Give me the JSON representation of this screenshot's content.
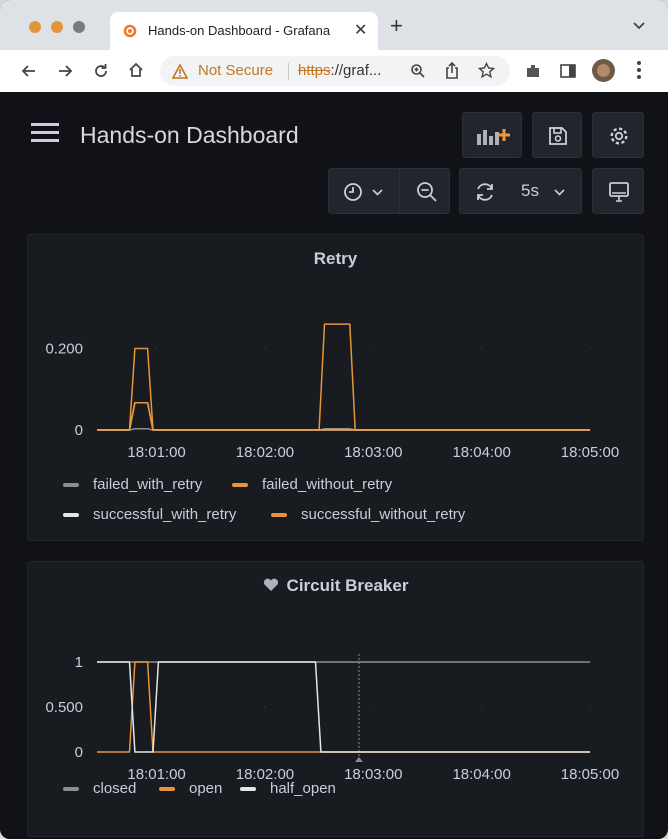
{
  "browser": {
    "tab_title": "Hands-on Dashboard - Grafana",
    "not_secure": "Not Secure",
    "url_scheme": "https",
    "url_rest": "://graf..."
  },
  "dashboard": {
    "title": "Hands-on Dashboard",
    "refresh_interval": "5s"
  },
  "colors": {
    "orange": "#e8953a",
    "gray": "#8e8e8e",
    "white": "#e6e6e6",
    "background": "#111217",
    "panel": "#181b1f"
  },
  "panels": [
    {
      "title": "Retry",
      "legend": [
        {
          "label": "failed_with_retry",
          "color": "#8e8e8e"
        },
        {
          "label": "failed_without_retry",
          "color": "#e8953a"
        },
        {
          "label": "successful_with_retry",
          "color": "#e6e6e6"
        },
        {
          "label": "successful_without_retry",
          "color": "#e8953a"
        }
      ]
    },
    {
      "title": "Circuit Breaker",
      "legend": [
        {
          "label": "closed",
          "color": "#8e8e8e"
        },
        {
          "label": "open",
          "color": "#e8953a"
        },
        {
          "label": "half_open",
          "color": "#e6e6e6"
        }
      ]
    }
  ],
  "chart_data": [
    {
      "type": "line",
      "title": "Retry",
      "x_ticks": [
        "18:01:00",
        "18:02:00",
        "18:03:00",
        "18:04:00",
        "18:05:00"
      ],
      "y_ticks": [
        "0",
        "0.200"
      ],
      "xlim": [
        "18:00:27",
        "18:05:00"
      ],
      "ylim": [
        0,
        0.27
      ],
      "series": [
        {
          "name": "failed_with_retry",
          "color": "#8e8e8e",
          "x": [
            "18:00:27",
            "18:00:45",
            "18:00:48",
            "18:00:55",
            "18:00:58",
            "18:02:30",
            "18:02:33",
            "18:02:47",
            "18:02:50",
            "18:05:00"
          ],
          "y": [
            0,
            0,
            0.003,
            0.003,
            0,
            0,
            0.003,
            0.003,
            0,
            0
          ]
        },
        {
          "name": "failed_without_retry",
          "color": "#e8953a",
          "x": [
            "18:00:27",
            "18:00:45",
            "18:00:48",
            "18:00:55",
            "18:00:58",
            "18:02:30",
            "18:02:33",
            "18:02:47",
            "18:02:50",
            "18:05:00"
          ],
          "y": [
            0,
            0,
            0.2,
            0.2,
            0,
            0,
            0.26,
            0.26,
            0,
            0
          ]
        },
        {
          "name": "successful_with_retry",
          "color": "#e6e6e6",
          "x": [
            "18:00:27",
            "18:00:45",
            "18:00:48",
            "18:00:55",
            "18:00:58",
            "18:05:00"
          ],
          "y": [
            0,
            0,
            0.067,
            0.067,
            0,
            0
          ]
        },
        {
          "name": "successful_without_retry",
          "color": "#e8953a",
          "x": [
            "18:00:27",
            "18:00:45",
            "18:00:48",
            "18:00:55",
            "18:00:58",
            "18:05:00"
          ],
          "y": [
            0,
            0,
            0.067,
            0.067,
            0,
            0
          ]
        }
      ]
    },
    {
      "type": "line",
      "title": "Circuit Breaker",
      "x_ticks": [
        "18:01:00",
        "18:02:00",
        "18:03:00",
        "18:04:00",
        "18:05:00"
      ],
      "y_ticks": [
        "0",
        "0.500",
        "1"
      ],
      "xlim": [
        "18:00:27",
        "18:05:00"
      ],
      "ylim": [
        0,
        1
      ],
      "series": [
        {
          "name": "closed",
          "color": "#8e8e8e",
          "x": [
            "18:00:27",
            "18:02:28",
            "18:02:31",
            "18:05:00"
          ],
          "y": [
            1,
            1,
            1,
            1
          ]
        },
        {
          "name": "open",
          "color": "#e8953a",
          "x": [
            "18:00:27",
            "18:00:45",
            "18:00:48",
            "18:00:55",
            "18:00:58",
            "18:05:00"
          ],
          "y": [
            0,
            0,
            1,
            1,
            0,
            0
          ]
        },
        {
          "name": "half_open",
          "color": "#e6e6e6",
          "x": [
            "18:00:27",
            "18:00:45",
            "18:00:48",
            "18:00:58",
            "18:01:01",
            "18:02:28",
            "18:02:31",
            "18:05:00"
          ],
          "y": [
            1,
            1,
            0,
            0,
            1,
            1,
            0,
            0
          ]
        }
      ]
    }
  ]
}
